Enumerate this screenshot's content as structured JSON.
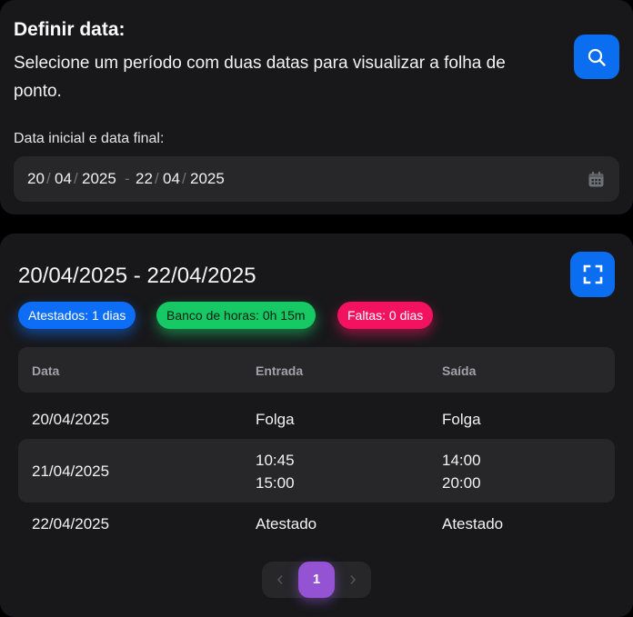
{
  "filter": {
    "title": "Definir data:",
    "description": "Selecione um período com duas datas para visualizar a folha de ponto.",
    "range_label": "Data inicial e data final:",
    "start": {
      "day": "20",
      "month": "04",
      "year": "2025"
    },
    "end": {
      "day": "22",
      "month": "04",
      "year": "2025"
    },
    "date_sep": "/",
    "range_sep": "-",
    "icons": {
      "search": "search-icon",
      "calendar": "calendar-icon"
    }
  },
  "report": {
    "title": "20/04/2025 - 22/04/2025",
    "chips": {
      "atestados": "Atestados: 1 dias",
      "banco": "Banco de horas: 0h 15m",
      "faltas": "Faltas: 0 dias"
    },
    "table": {
      "headers": [
        "Data",
        "Entrada",
        "Saída"
      ],
      "rows": [
        {
          "date": "20/04/2025",
          "entrada": [
            "Folga"
          ],
          "saida": [
            "Folga"
          ]
        },
        {
          "date": "21/04/2025",
          "entrada": [
            "10:45",
            "15:00"
          ],
          "saida": [
            "14:00",
            "20:00"
          ]
        },
        {
          "date": "22/04/2025",
          "entrada": [
            "Atestado"
          ],
          "saida": [
            "Atestado"
          ]
        }
      ]
    },
    "pagination": {
      "current": "1",
      "prev": "‹",
      "next": "›"
    }
  },
  "colors": {
    "primary": "#0b6ef0",
    "success": "#17c964",
    "danger": "#f31260",
    "secondary": "#9353d3",
    "card_bg": "#18181b",
    "surface": "#27272a"
  }
}
